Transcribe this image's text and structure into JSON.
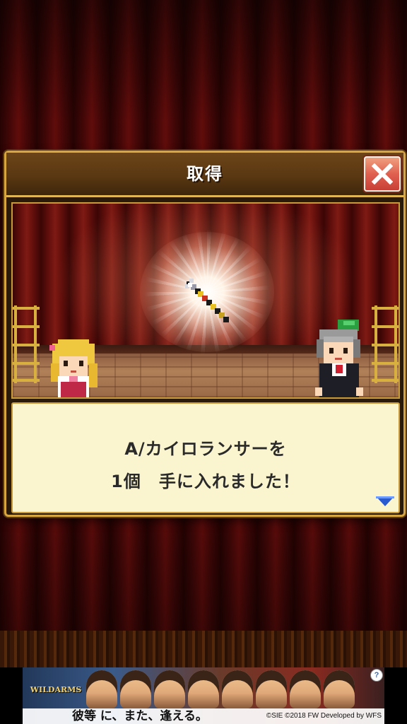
{
  "dialog": {
    "title": "取得",
    "close_icon": "close-x-icon"
  },
  "scene": {
    "item_icon": "spear-weapon-icon",
    "characters": [
      "blonde-girl-sprite",
      "gray-haired-man-sprite"
    ]
  },
  "message": {
    "line1": "A/カイロランサーを",
    "line2": "1個　手に入れました！",
    "next_icon": "triangle-down-icon"
  },
  "ad": {
    "logo": "WILDARMS",
    "tagline": "彼等 に、また、逢える。",
    "credit": "©SIE ©2018 FW Developed by WFS",
    "info": "?"
  },
  "colors": {
    "frame_gold": "#d8a640",
    "header_brown": "#5a3812",
    "close_red": "#e06050",
    "message_bg": "#fbf5cf",
    "indicator_blue": "#2a5ad0"
  }
}
